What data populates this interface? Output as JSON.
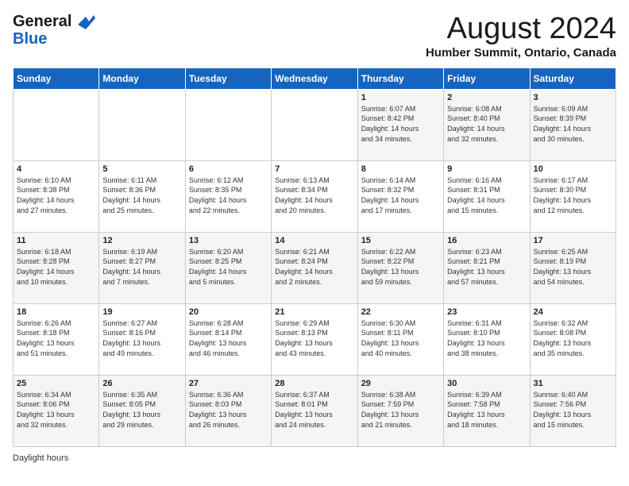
{
  "header": {
    "logo_line1": "General",
    "logo_line2": "Blue",
    "month": "August 2024",
    "location": "Humber Summit, Ontario, Canada"
  },
  "weekdays": [
    "Sunday",
    "Monday",
    "Tuesday",
    "Wednesday",
    "Thursday",
    "Friday",
    "Saturday"
  ],
  "weeks": [
    [
      {
        "day": "",
        "info": ""
      },
      {
        "day": "",
        "info": ""
      },
      {
        "day": "",
        "info": ""
      },
      {
        "day": "",
        "info": ""
      },
      {
        "day": "1",
        "info": "Sunrise: 6:07 AM\nSunset: 8:42 PM\nDaylight: 14 hours\nand 34 minutes."
      },
      {
        "day": "2",
        "info": "Sunrise: 6:08 AM\nSunset: 8:40 PM\nDaylight: 14 hours\nand 32 minutes."
      },
      {
        "day": "3",
        "info": "Sunrise: 6:09 AM\nSunset: 8:39 PM\nDaylight: 14 hours\nand 30 minutes."
      }
    ],
    [
      {
        "day": "4",
        "info": "Sunrise: 6:10 AM\nSunset: 8:38 PM\nDaylight: 14 hours\nand 27 minutes."
      },
      {
        "day": "5",
        "info": "Sunrise: 6:11 AM\nSunset: 8:36 PM\nDaylight: 14 hours\nand 25 minutes."
      },
      {
        "day": "6",
        "info": "Sunrise: 6:12 AM\nSunset: 8:35 PM\nDaylight: 14 hours\nand 22 minutes."
      },
      {
        "day": "7",
        "info": "Sunrise: 6:13 AM\nSunset: 8:34 PM\nDaylight: 14 hours\nand 20 minutes."
      },
      {
        "day": "8",
        "info": "Sunrise: 6:14 AM\nSunset: 8:32 PM\nDaylight: 14 hours\nand 17 minutes."
      },
      {
        "day": "9",
        "info": "Sunrise: 6:16 AM\nSunset: 8:31 PM\nDaylight: 14 hours\nand 15 minutes."
      },
      {
        "day": "10",
        "info": "Sunrise: 6:17 AM\nSunset: 8:30 PM\nDaylight: 14 hours\nand 12 minutes."
      }
    ],
    [
      {
        "day": "11",
        "info": "Sunrise: 6:18 AM\nSunset: 8:28 PM\nDaylight: 14 hours\nand 10 minutes."
      },
      {
        "day": "12",
        "info": "Sunrise: 6:19 AM\nSunset: 8:27 PM\nDaylight: 14 hours\nand 7 minutes."
      },
      {
        "day": "13",
        "info": "Sunrise: 6:20 AM\nSunset: 8:25 PM\nDaylight: 14 hours\nand 5 minutes."
      },
      {
        "day": "14",
        "info": "Sunrise: 6:21 AM\nSunset: 8:24 PM\nDaylight: 14 hours\nand 2 minutes."
      },
      {
        "day": "15",
        "info": "Sunrise: 6:22 AM\nSunset: 8:22 PM\nDaylight: 13 hours\nand 59 minutes."
      },
      {
        "day": "16",
        "info": "Sunrise: 6:23 AM\nSunset: 8:21 PM\nDaylight: 13 hours\nand 57 minutes."
      },
      {
        "day": "17",
        "info": "Sunrise: 6:25 AM\nSunset: 8:19 PM\nDaylight: 13 hours\nand 54 minutes."
      }
    ],
    [
      {
        "day": "18",
        "info": "Sunrise: 6:26 AM\nSunset: 8:18 PM\nDaylight: 13 hours\nand 51 minutes."
      },
      {
        "day": "19",
        "info": "Sunrise: 6:27 AM\nSunset: 8:16 PM\nDaylight: 13 hours\nand 49 minutes."
      },
      {
        "day": "20",
        "info": "Sunrise: 6:28 AM\nSunset: 8:14 PM\nDaylight: 13 hours\nand 46 minutes."
      },
      {
        "day": "21",
        "info": "Sunrise: 6:29 AM\nSunset: 8:13 PM\nDaylight: 13 hours\nand 43 minutes."
      },
      {
        "day": "22",
        "info": "Sunrise: 6:30 AM\nSunset: 8:11 PM\nDaylight: 13 hours\nand 40 minutes."
      },
      {
        "day": "23",
        "info": "Sunrise: 6:31 AM\nSunset: 8:10 PM\nDaylight: 13 hours\nand 38 minutes."
      },
      {
        "day": "24",
        "info": "Sunrise: 6:32 AM\nSunset: 8:08 PM\nDaylight: 13 hours\nand 35 minutes."
      }
    ],
    [
      {
        "day": "25",
        "info": "Sunrise: 6:34 AM\nSunset: 8:06 PM\nDaylight: 13 hours\nand 32 minutes."
      },
      {
        "day": "26",
        "info": "Sunrise: 6:35 AM\nSunset: 8:05 PM\nDaylight: 13 hours\nand 29 minutes."
      },
      {
        "day": "27",
        "info": "Sunrise: 6:36 AM\nSunset: 8:03 PM\nDaylight: 13 hours\nand 26 minutes."
      },
      {
        "day": "28",
        "info": "Sunrise: 6:37 AM\nSunset: 8:01 PM\nDaylight: 13 hours\nand 24 minutes."
      },
      {
        "day": "29",
        "info": "Sunrise: 6:38 AM\nSunset: 7:59 PM\nDaylight: 13 hours\nand 21 minutes."
      },
      {
        "day": "30",
        "info": "Sunrise: 6:39 AM\nSunset: 7:58 PM\nDaylight: 13 hours\nand 18 minutes."
      },
      {
        "day": "31",
        "info": "Sunrise: 6:40 AM\nSunset: 7:56 PM\nDaylight: 13 hours\nand 15 minutes."
      }
    ]
  ],
  "footer": {
    "daylight_label": "Daylight hours"
  }
}
